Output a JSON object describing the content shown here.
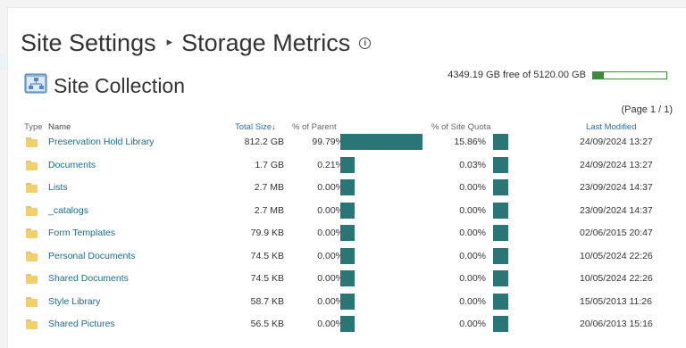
{
  "breadcrumb": {
    "root": "Site Settings",
    "separator": "▸",
    "current": "Storage Metrics",
    "info_icon": "info-icon"
  },
  "section": {
    "title": "Site Collection",
    "icon": "site-collection-icon"
  },
  "quota": {
    "text": "4349.19 GB free of 5120.00 GB",
    "used_fraction": 0.15,
    "color": "#3d8c3d"
  },
  "pager": "(Page 1 / 1)",
  "columns": {
    "type": "Type",
    "name": "Name",
    "total_size": "Total Size",
    "sort_icon": "sort-descending-icon",
    "pct_parent": "% of Parent",
    "pct_quota": "% of Site Quota",
    "last_modified": "Last Modified"
  },
  "accent_color": "#2a7575",
  "rows": [
    {
      "name": "Preservation Hold Library",
      "size": "812.2 GB",
      "pct_parent": "99.79%",
      "pct_quota": "15.86%",
      "modified": "24/09/2024 13:27",
      "parent_fraction": 0.9979
    },
    {
      "name": "Documents",
      "size": "1.7 GB",
      "pct_parent": "0.21%",
      "pct_quota": "0.03%",
      "modified": "24/09/2024 13:27",
      "parent_fraction": 0.0021
    },
    {
      "name": "Lists",
      "size": "2.7 MB",
      "pct_parent": "0.00%",
      "pct_quota": "0.00%",
      "modified": "23/09/2024 14:37",
      "parent_fraction": 0
    },
    {
      "name": "_catalogs",
      "size": "2.7 MB",
      "pct_parent": "0.00%",
      "pct_quota": "0.00%",
      "modified": "23/09/2024 14:37",
      "parent_fraction": 0
    },
    {
      "name": "Form Templates",
      "size": "79.9 KB",
      "pct_parent": "0.00%",
      "pct_quota": "0.00%",
      "modified": "02/06/2015 20:47",
      "parent_fraction": 0
    },
    {
      "name": "Personal Documents",
      "size": "74.5 KB",
      "pct_parent": "0.00%",
      "pct_quota": "0.00%",
      "modified": "10/05/2024 22:26",
      "parent_fraction": 0
    },
    {
      "name": "Shared Documents",
      "size": "74.5 KB",
      "pct_parent": "0.00%",
      "pct_quota": "0.00%",
      "modified": "10/05/2024 22:26",
      "parent_fraction": 0
    },
    {
      "name": "Style Library",
      "size": "58.7 KB",
      "pct_parent": "0.00%",
      "pct_quota": "0.00%",
      "modified": "15/05/2013 11:26",
      "parent_fraction": 0
    },
    {
      "name": "Shared Pictures",
      "size": "56.5 KB",
      "pct_parent": "0.00%",
      "pct_quota": "0.00%",
      "modified": "20/06/2013 15:16",
      "parent_fraction": 0
    }
  ]
}
